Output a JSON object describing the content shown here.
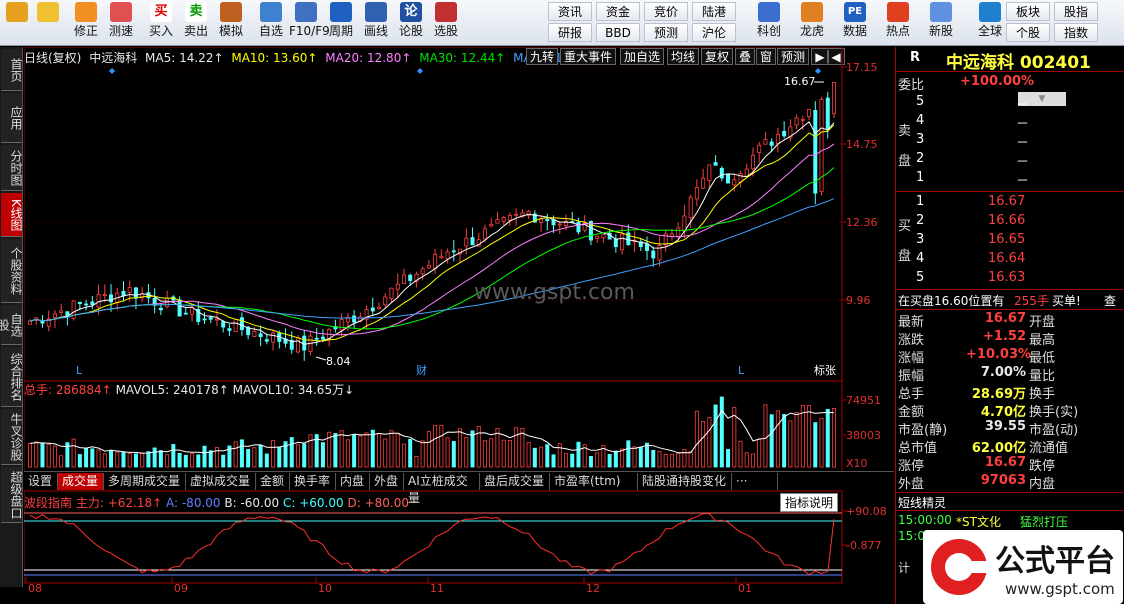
{
  "toolbar": {
    "big": [
      {
        "label": "",
        "icon": "grid-icon"
      },
      {
        "label": "",
        "icon": "back-arrow-icon"
      },
      {
        "label": "修正",
        "icon": "fix-icon"
      },
      {
        "label": "测速",
        "icon": "speed-test-icon"
      },
      {
        "label": "买入",
        "icon": "buy-icon",
        "glyph": "买"
      },
      {
        "label": "卖出",
        "icon": "sell-icon",
        "glyph": "卖"
      },
      {
        "label": "模拟",
        "icon": "hammer-icon"
      },
      {
        "label": "自选",
        "icon": "star-icon"
      },
      {
        "label": "F10/F9",
        "icon": "f10-icon"
      },
      {
        "label": "周期",
        "icon": "clock-icon"
      },
      {
        "label": "画线",
        "icon": "pencil-icon"
      },
      {
        "label": "论股",
        "icon": "discuss-icon",
        "glyph": "论"
      },
      {
        "label": "选股",
        "icon": "pick-stock-icon"
      }
    ],
    "grid": [
      [
        "资讯",
        "资金",
        "竞价",
        "陆港"
      ],
      [
        "研报",
        "BBD",
        "预测",
        "沪伦"
      ]
    ],
    "big2": [
      {
        "label": "科创",
        "icon": "kechuang-icon"
      },
      {
        "label": "龙虎",
        "icon": "longhu-icon"
      },
      {
        "label": "数据",
        "icon": "pe-data-icon",
        "glyph": "PE"
      },
      {
        "label": "热点",
        "icon": "hot-icon"
      },
      {
        "label": "新股",
        "icon": "ipo-icon"
      },
      {
        "label": "全球",
        "icon": "globe-icon"
      }
    ],
    "grid2": [
      [
        "板块",
        "股指"
      ],
      [
        "个股",
        "指数"
      ]
    ]
  },
  "left_tabs": [
    "首页",
    "应用",
    "分时图",
    "K线图",
    "个股资料",
    "自选股",
    "综合排名",
    "牛叉诊股",
    "超级盘口"
  ],
  "chart": {
    "header": {
      "period": "日线(复权)",
      "name": "中远海科",
      "ma5": "MA5: 14.22↑",
      "ma10": "MA10: 13.60↑",
      "ma20": "MA20: 12.80↑",
      "ma30": "MA30: 12.44↑",
      "ma60": "MA60: 11.9"
    },
    "buttons": [
      "九转",
      "重大事件",
      "加自选",
      "均线",
      "复权",
      "叠",
      "窗",
      "预测"
    ],
    "price_axis": [
      "17.15",
      "14.75",
      "12.36",
      "9.96"
    ],
    "high_label": "16.67",
    "low_label": "8.04",
    "markers": [
      "L",
      "财",
      "L",
      "标张"
    ],
    "watermark": "www.gspt.com",
    "vol_header": {
      "total": "总手: 286884↑",
      "mavol5": "MAVOL5: 240178↑",
      "mavol10": "MAVOL10: 34.65万↓"
    },
    "vol_axis": [
      "74951",
      "38003",
      "X10"
    ],
    "tabs": [
      "设置",
      "成交量",
      "多周期成交量",
      "虚拟成交量",
      "金额",
      "换手率",
      "内盘",
      "外盘",
      "AI立桩成交量",
      "盘后成交量",
      "市盈率(ttm)",
      "陆股通持股变化",
      "···"
    ],
    "indicator_btn": "指标说明",
    "ind_header": {
      "name": "波段指南",
      "main": "主力: +62.18↑",
      "a": "A: -80.00",
      "b": "B: -60.00",
      "c": "C: +60.00",
      "d": "D: +80.00"
    },
    "ind_axis": [
      "+90.08",
      "-0.877"
    ],
    "months": [
      "08",
      "09",
      "10",
      "11",
      "12",
      "01"
    ]
  },
  "chart_data": {
    "type": "candlestick",
    "title": "中远海科",
    "price_range": [
      7.6,
      17.15
    ],
    "series_note": "daily K-line with MA5/MA10/MA20/MA30/MA60",
    "max": 16.67,
    "min": 8.04,
    "volume_range": [
      0,
      90000
    ],
    "indicator_range": [
      -90,
      90.08
    ]
  },
  "quote": {
    "code_title": "R",
    "name": "中远海科 002401",
    "webi_label": "委比",
    "webi": "+100.00%",
    "sell_label": "卖盘",
    "buy_label": "买盘",
    "sell": [
      {
        "n": "5",
        "p": "－"
      },
      {
        "n": "4",
        "p": "－"
      },
      {
        "n": "3",
        "p": "－"
      },
      {
        "n": "2",
        "p": "－"
      },
      {
        "n": "1",
        "p": "－"
      }
    ],
    "buy": [
      {
        "n": "1",
        "p": "16.67"
      },
      {
        "n": "2",
        "p": "16.66"
      },
      {
        "n": "3",
        "p": "16.65"
      },
      {
        "n": "4",
        "p": "16.64"
      },
      {
        "n": "5",
        "p": "16.63"
      }
    ],
    "notice": "在买盘16.60位置有",
    "notice_n": "255手",
    "notice_t": "买单!",
    "notice_x": "查",
    "rows": [
      {
        "l": "最新",
        "v": "16.67",
        "r": "开盘",
        "c": "red"
      },
      {
        "l": "涨跌",
        "v": "+1.52",
        "r": "最高",
        "c": "red"
      },
      {
        "l": "涨幅",
        "v": "+10.03%",
        "r": "最低",
        "c": "red"
      },
      {
        "l": "振幅",
        "v": "7.00%",
        "r": "量比",
        "c": "white"
      },
      {
        "l": "总手",
        "v": "28.69万",
        "r": "换手",
        "c": "yellow"
      },
      {
        "l": "金额",
        "v": "4.70亿",
        "r": "换手(实)",
        "c": "yellow"
      },
      {
        "l": "市盈(静)",
        "v": "39.55",
        "r": "市盈(动)",
        "c": "white"
      },
      {
        "l": "总市值",
        "v": "62.00亿",
        "r": "流通值",
        "c": "yellow"
      },
      {
        "l": "涨停",
        "v": "16.67",
        "r": "跌停",
        "c": "red"
      },
      {
        "l": "外盘",
        "v": "97063",
        "r": "内盘",
        "c": "red"
      }
    ],
    "short_title": "短线精灵",
    "short": [
      {
        "t": "15:00:00",
        "n": "*ST文化",
        "e": "猛烈打压"
      },
      {
        "t": "15:00:00",
        "n": "魅视科技",
        "e": "急速拉升"
      }
    ],
    "calc_stub": "计"
  },
  "logo": {
    "text": "公式平台",
    "url": "www.gspt.com"
  },
  "colors": {
    "up": "#ff4040",
    "down": "#54ffff",
    "ma5": "#ffffff",
    "ma10": "#ffff00",
    "ma20": "#ff80ff",
    "ma30": "#00ff00",
    "ma60": "#40a0ff"
  }
}
